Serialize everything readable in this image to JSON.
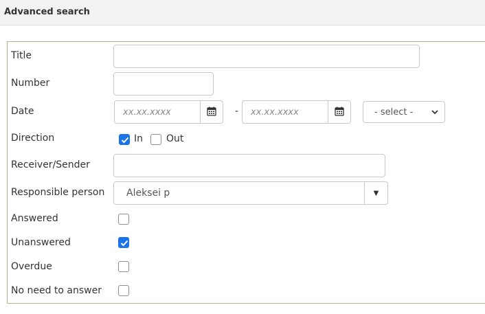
{
  "header": {
    "title": "Advanced search"
  },
  "form": {
    "labels": {
      "title": "Title",
      "number": "Number",
      "date": "Date",
      "direction": "Direction",
      "receiver": "Receiver/Sender",
      "responsible": "Responsible person",
      "answered": "Answered",
      "unanswered": "Unanswered",
      "overdue": "Overdue",
      "no_need": "No need to answer"
    },
    "title_value": "",
    "number_value": "",
    "receiver_value": "",
    "date_from_placeholder": "xx.xx.xxxx",
    "date_to_placeholder": "xx.xx.xxxx",
    "date_separator": "-",
    "date_select": "- select -",
    "direction_in": {
      "label": "In",
      "checked": true
    },
    "direction_out": {
      "label": "Out",
      "checked": false
    },
    "responsible_value": "Aleksei p",
    "answered_checked": false,
    "unanswered_checked": true,
    "overdue_checked": false,
    "no_need_checked": false
  },
  "colors": {
    "accent": "#1a73e8",
    "panel_border": "#b8b08a",
    "header_bg": "#f2f2f2"
  },
  "icons": {
    "calendar": "calendar-icon",
    "select_chevron": "chevron-down-icon",
    "combo_arrow": "caret-down-icon",
    "check": "checkmark-icon"
  }
}
